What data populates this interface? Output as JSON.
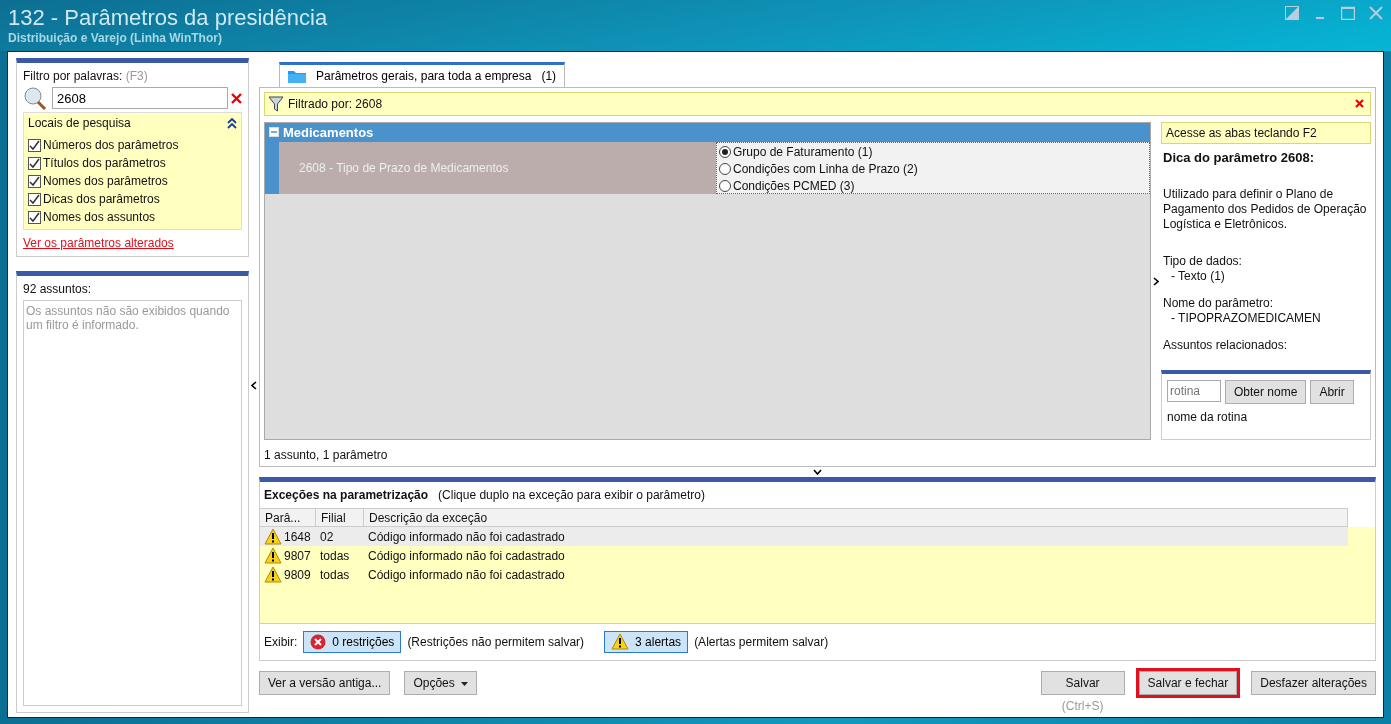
{
  "window": {
    "title": "132 - Parâmetros da presidência",
    "subtitle": "Distribuição e Varejo (Linha WinThor)"
  },
  "filter": {
    "label": "Filtro por palavras:",
    "shortcut": "(F3)",
    "value": "2608",
    "locations": {
      "title": "Locais de pesquisa",
      "expanded": true,
      "items": [
        {
          "label": "Números dos parâmetros",
          "checked": true
        },
        {
          "label": "Títulos dos parâmetros",
          "checked": true
        },
        {
          "label": "Nomes dos parâmetros",
          "checked": true
        },
        {
          "label": "Dicas dos parâmetros",
          "checked": true
        },
        {
          "label": "Nomes dos assuntos",
          "checked": true
        }
      ]
    },
    "link": "Ver os parâmetros alterados"
  },
  "subjects": {
    "count": "92 assuntos:",
    "message": "Os assuntos não são exibidos quando um filtro é informado."
  },
  "tabs": [
    {
      "label": "Parâmetros gerais, para toda a empresa",
      "count": "(1)",
      "selected": true
    }
  ],
  "filter_bar": {
    "text": "Filtrado por: 2608"
  },
  "groups": [
    {
      "name": "Medicamentos",
      "expanded": true,
      "params": [
        {
          "title": "2608 - Tipo de Prazo de Medicamentos",
          "options": [
            {
              "label": "Grupo de Faturamento (1)",
              "selected": true
            },
            {
              "label": "Condições com Linha de Prazo (2)",
              "selected": false
            },
            {
              "label": "Condições PCMED (3)",
              "selected": false
            }
          ]
        }
      ]
    }
  ],
  "status": "1 assunto, 1 parâmetro",
  "hint": {
    "banner": "Acesse as abas teclando F2",
    "title": "Dica do parâmetro 2608:",
    "lines": [
      {
        "kind": "para",
        "text": "Utilizado para definir o Plano de Pagamento dos Pedidos de Operação Logística e Eletrônicos."
      },
      {
        "kind": "head",
        "text": "Tipo de dados:"
      },
      {
        "kind": "item",
        "text": "- Texto (1)"
      },
      {
        "kind": "head",
        "text": "Nome do parâmetro:"
      },
      {
        "kind": "item",
        "text": "- TIPOPRAZOMEDICAMEN"
      },
      {
        "kind": "head",
        "text": "Assuntos relacionados:"
      }
    ]
  },
  "routine": {
    "placeholder": "rotina",
    "buttons": [
      "Obter nome",
      "Abrir"
    ],
    "name": "nome da rotina"
  },
  "exceptions": {
    "title": "Exceções na parametrização",
    "hint": "(Clique duplo na exceção para exibir o parâmetro)",
    "columns": [
      "Parâ...",
      "Filial",
      "Descrição da exceção"
    ],
    "rows": [
      {
        "kind": "warning",
        "param": "1648",
        "branch": "02",
        "description": "Código informado não foi cadastrado",
        "selected": true
      },
      {
        "kind": "warning",
        "param": "9807",
        "branch": "todas",
        "description": "Código informado não foi cadastrado",
        "selected": false
      },
      {
        "kind": "warning",
        "param": "9809",
        "branch": "todas",
        "description": "Código informado não foi cadastrado",
        "selected": false
      }
    ],
    "show_label": "Exibir:",
    "toggles": [
      {
        "kind": "error",
        "label": "0 restrições",
        "note": "(Restrições não permitem salvar)",
        "pressed": true
      },
      {
        "kind": "warning",
        "label": "3 alertas",
        "note": "(Alertas permitem salvar)",
        "pressed": true
      }
    ]
  },
  "buttons_left": [
    {
      "label": "Ver a versão antiga...",
      "dropdown": false
    },
    {
      "label": "Opções",
      "dropdown": true
    }
  ],
  "buttons_right": [
    {
      "label": "Salvar",
      "shortcut": "(Ctrl+S)",
      "highlighted": false
    },
    {
      "label": "Salvar e fechar",
      "highlighted": true
    },
    {
      "label": "Desfazer alterações",
      "highlighted": false
    }
  ]
}
